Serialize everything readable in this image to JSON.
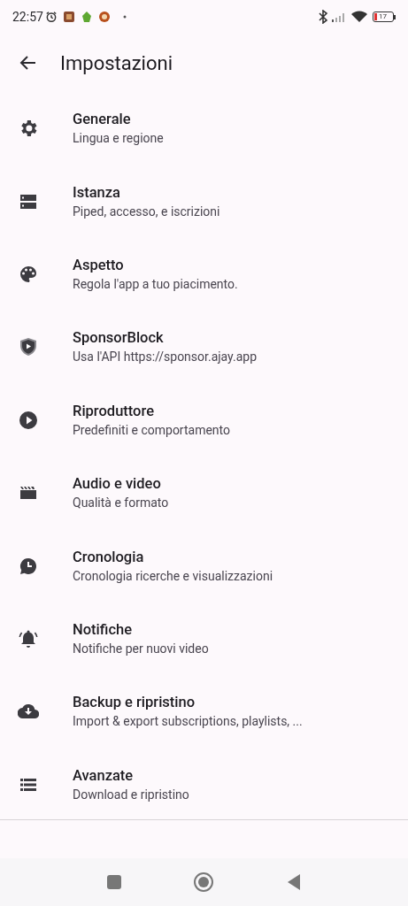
{
  "status_bar": {
    "time": "22:57",
    "battery": "17"
  },
  "app_bar": {
    "title": "Impostazioni"
  },
  "settings": [
    {
      "kind": "gear",
      "title": "Generale",
      "subtitle": "Lingua e regione"
    },
    {
      "kind": "server",
      "title": "Istanza",
      "subtitle": "Piped, accesso, e iscrizioni"
    },
    {
      "kind": "palette",
      "title": "Aspetto",
      "subtitle": "Regola l'app a tuo piacimento."
    },
    {
      "kind": "shield",
      "title": "SponsorBlock",
      "subtitle": "Usa l'API https://sponsor.ajay.app"
    },
    {
      "kind": "play",
      "title": "Riproduttore",
      "subtitle": "Predefiniti e comportamento"
    },
    {
      "kind": "clapper",
      "title": "Audio e video",
      "subtitle": "Qualità e formato"
    },
    {
      "kind": "history",
      "title": "Cronologia",
      "subtitle": "Cronologia ricerche e visualizzazioni"
    },
    {
      "kind": "bell",
      "title": "Notifiche",
      "subtitle": "Notifiche per nuovi video"
    },
    {
      "kind": "cloud",
      "title": "Backup e ripristino",
      "subtitle": "Import & export subscriptions, playlists, ..."
    },
    {
      "kind": "list",
      "title": "Avanzate",
      "subtitle": "Download e ripristino"
    }
  ]
}
